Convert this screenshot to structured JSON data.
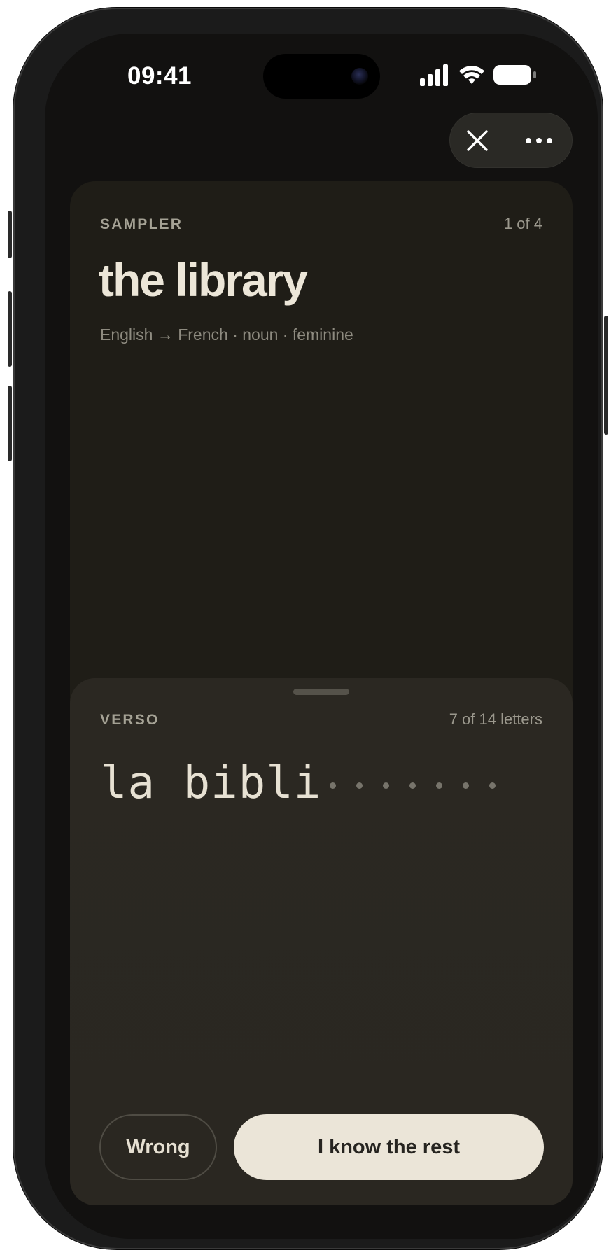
{
  "status_bar": {
    "time": "09:41",
    "icons": [
      "cellular-signal-icon",
      "wifi-icon",
      "battery-icon"
    ]
  },
  "top_controls": {
    "icons": [
      "close-icon",
      "more-icon"
    ]
  },
  "front": {
    "label": "SAMPLER",
    "counter": "1 of 4",
    "word": "the library",
    "meta": "English → French · noun · feminine"
  },
  "verso": {
    "label": "VERSO",
    "counter": "7 of 14 letters",
    "revealed_text": "la bibli",
    "hidden_letters": 7
  },
  "actions": {
    "wrong_label": "Wrong",
    "know_label": "I know the rest"
  },
  "colors": {
    "screen_background": "#121110",
    "card_background": "#1f1d17",
    "sheet_background": "#2b2822",
    "primary_button": "#ebe5d8",
    "text_primary": "#ece6d8",
    "text_secondary": "#8e8b80"
  }
}
